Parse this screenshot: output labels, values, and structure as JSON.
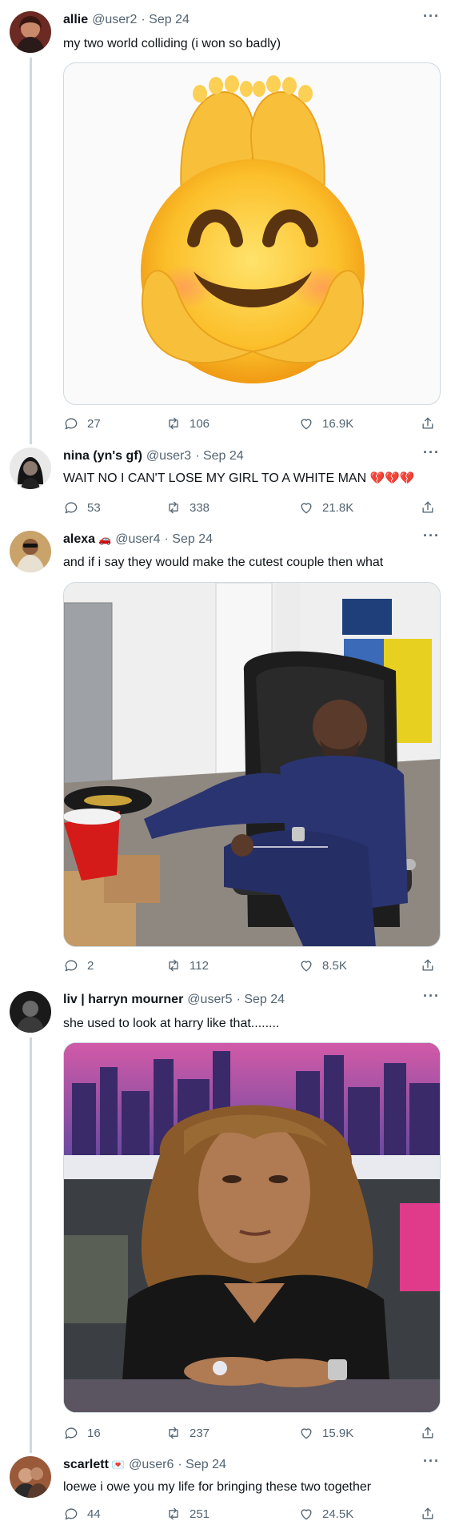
{
  "tweets": [
    {
      "name": "allie",
      "handle": "@user2",
      "date": "· Sep 24",
      "text": "my two world colliding (i won so badly)",
      "replies": "27",
      "retweets": "106",
      "likes": "16.9K",
      "media": "emoji-feet-smile"
    },
    {
      "name": "nina (yn's gf)",
      "handle": "@user3",
      "date": "· Sep 24",
      "text": "WAIT NO I CAN'T LOSE MY GIRL TO A WHITE MAN",
      "emoji": "💔💔💔",
      "replies": "53",
      "retweets": "338",
      "likes": "21.8K"
    },
    {
      "name": "alexa",
      "badge": "🚗",
      "handle": "@user4",
      "date": "· Sep 24",
      "text": "and if i say they would make the cutest couple then what",
      "replies": "2",
      "retweets": "112",
      "likes": "8.5K",
      "media": "man-in-chair-photo"
    },
    {
      "name": "liv | harryn mourner",
      "handle": "@user5",
      "date": "· Sep 24",
      "text": "she used to look at harry like that........",
      "replies": "16",
      "retweets": "237",
      "likes": "15.9K",
      "media": "woman-city-background-photo"
    },
    {
      "name": "scarlett",
      "badge": "💌",
      "handle": "@user6",
      "date": "· Sep 24",
      "text": "loewe i owe you my life for bringing these two together",
      "replies": "44",
      "retweets": "251",
      "likes": "24.5K"
    }
  ],
  "more_label": "···",
  "icons": {
    "reply": "reply-icon",
    "retweet": "retweet-icon",
    "like": "heart-icon",
    "share": "share-icon"
  },
  "colors": {
    "text": "#0f1419",
    "secondary": "#536471",
    "border": "#cfd9de",
    "heart": "#e0245e"
  }
}
